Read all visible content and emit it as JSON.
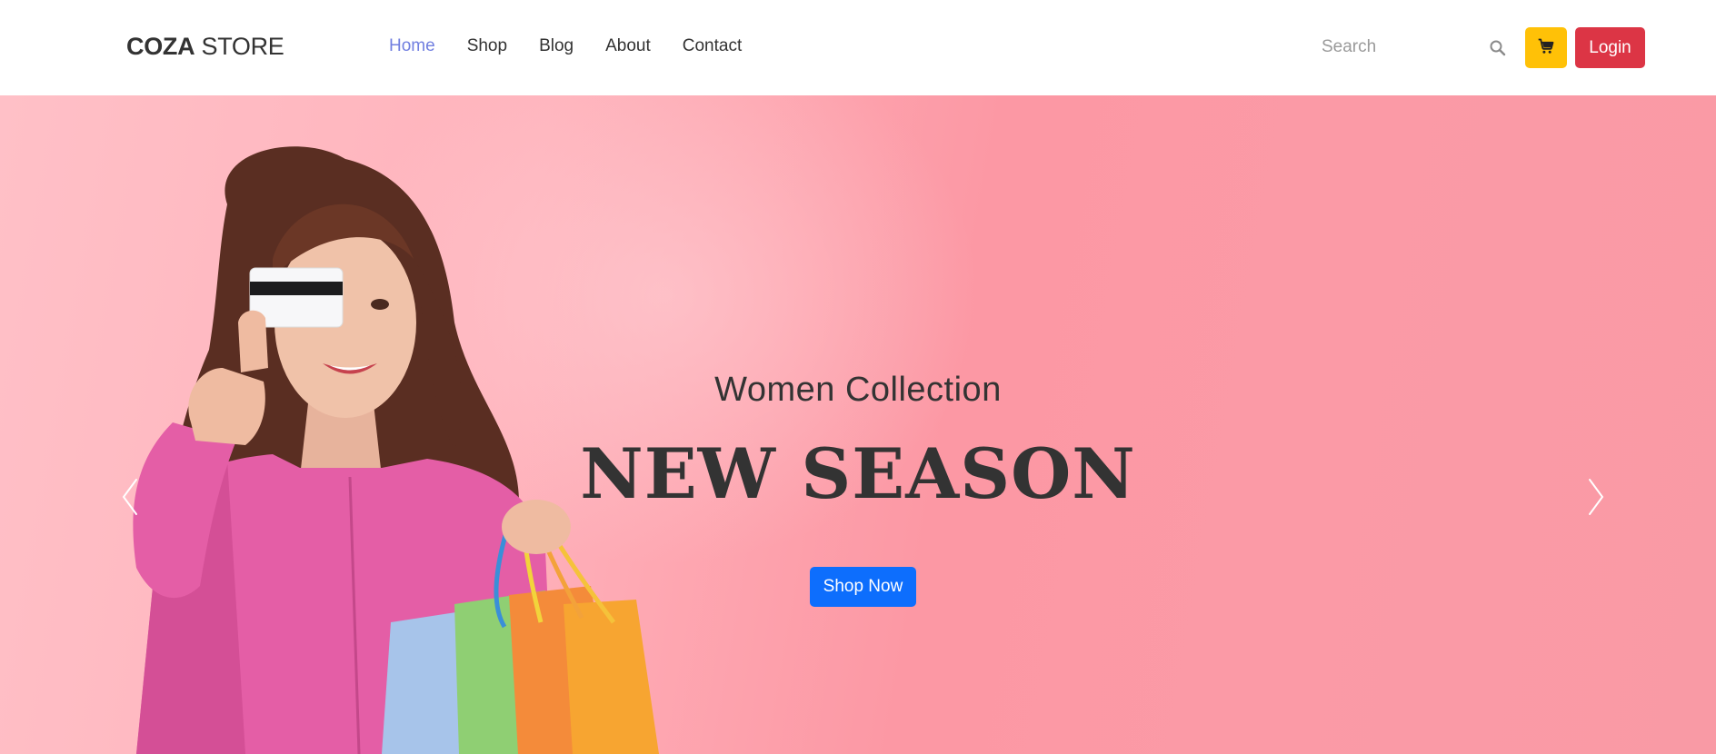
{
  "header": {
    "logo_bold": "COZA",
    "logo_regular": " STORE",
    "nav": [
      {
        "label": "Home",
        "active": true
      },
      {
        "label": "Shop"
      },
      {
        "label": "Blog"
      },
      {
        "label": "About"
      },
      {
        "label": "Contact"
      }
    ],
    "search": {
      "placeholder": "Search",
      "icon": "search-icon"
    },
    "cart": {
      "icon": "cart-icon",
      "color": "#ffc107"
    },
    "login_label": "Login",
    "login_color": "#dc3545",
    "active_color": "#717fe0"
  },
  "hero": {
    "subtitle": "Women Collection",
    "title": "NEW SEASON",
    "cta_label": "Shop Now",
    "cta_color": "#0d6efd",
    "prev_icon": "chevron-left-icon",
    "next_icon": "chevron-right-icon",
    "image": "woman-with-card-and-shopping-bags"
  }
}
